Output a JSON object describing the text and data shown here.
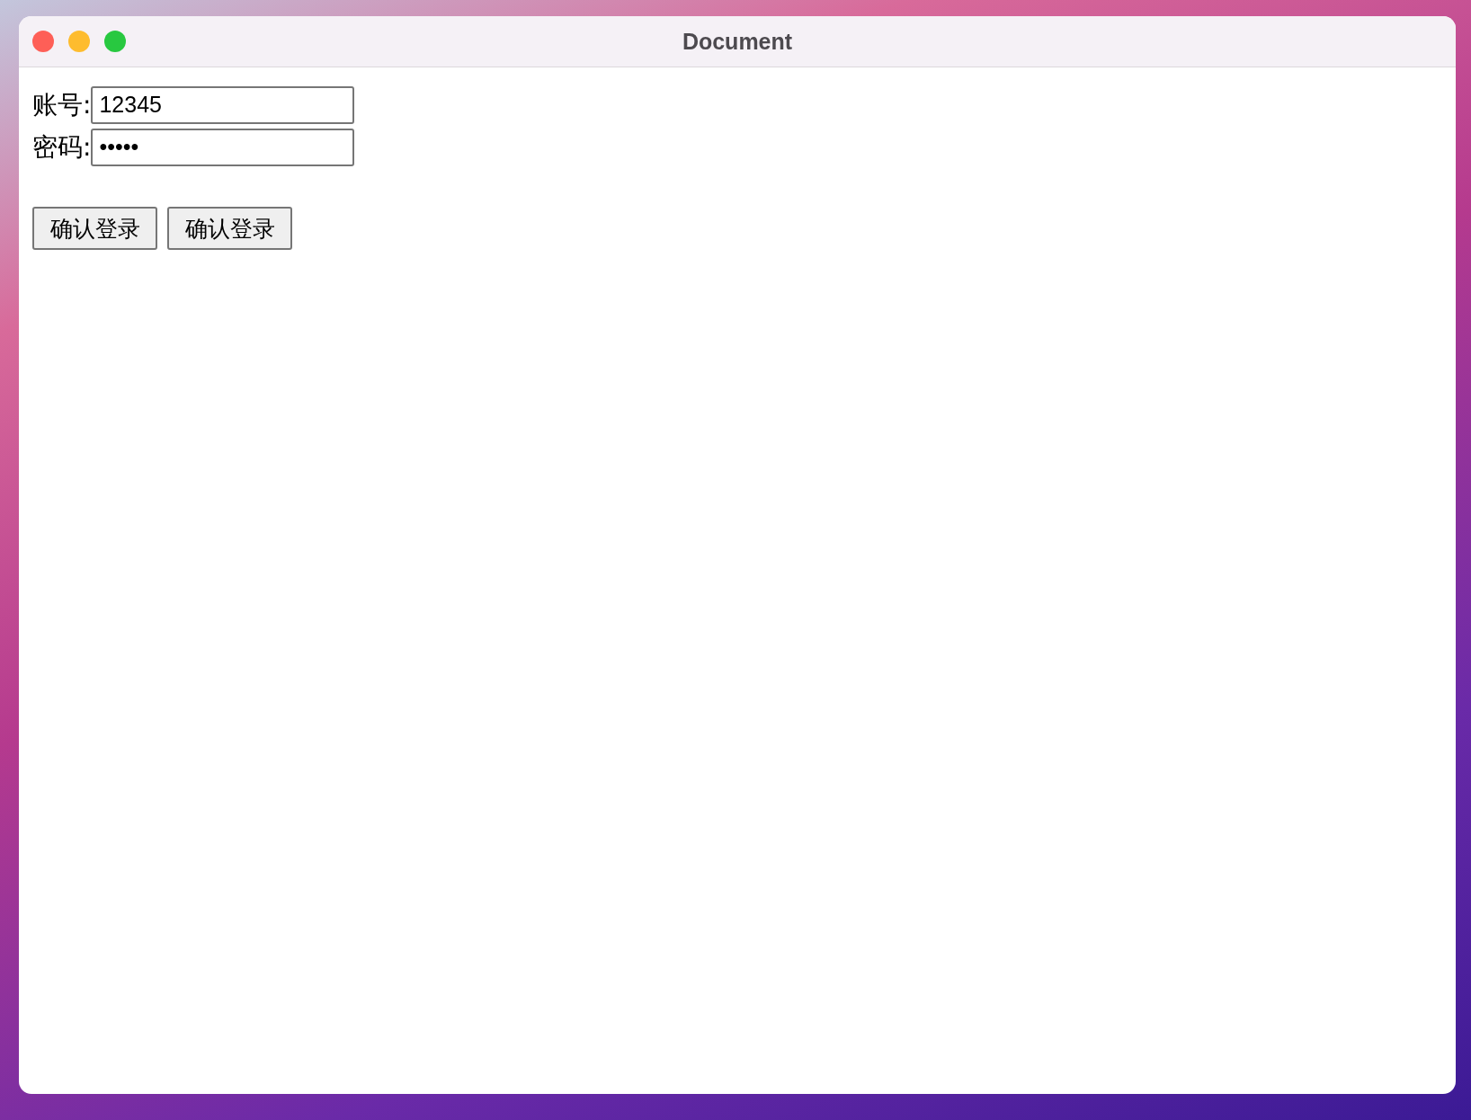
{
  "window": {
    "title": "Document"
  },
  "account_field": {
    "label": "账号:",
    "value": "12345"
  },
  "password_field": {
    "label": "密码:",
    "value": "•••••"
  },
  "buttons": [
    "确认登录",
    "确认登录"
  ]
}
